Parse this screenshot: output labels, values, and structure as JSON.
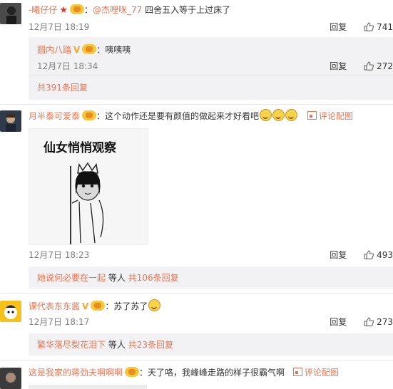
{
  "comments": [
    {
      "user": "-曦仔仔",
      "mention": "@杰哩咪_77",
      "text": "四舍五入等于上过床了",
      "time": "12月7日 18:19",
      "reply_label": "回复",
      "likes": "741",
      "sub_reply": {
        "user": "圆内八踏",
        "text": "：咦咦咦",
        "time": "12月7日 18:34",
        "reply_label": "回复",
        "likes": "272"
      },
      "total_replies": "共391条回复"
    },
    {
      "user": "月半泰可爱泰",
      "text": "：这个动作还是要有颜值的做起来才好看吧",
      "image_link": "评论配图",
      "meme_caption": "仙女悄悄观察",
      "time": "12月7日 18:23",
      "reply_label": "回复",
      "likes": "493",
      "reply_summary": {
        "user": "她说何必要在一起",
        "others": "等人",
        "count": "共106条回复"
      }
    },
    {
      "user": "课代表东东酱",
      "text": "：苏了苏了",
      "time": "12月7日 18:17",
      "reply_label": "回复",
      "likes": "273",
      "reply_summary": {
        "user": "繁华落尽梨花泪下",
        "others": "等人",
        "count": "共23条回复"
      }
    },
    {
      "user": "这是我家的蒋劲夫啊啊啊",
      "text": "：天了咯，我峰峰走路的样子很霸气啊",
      "image_link": "评论配图"
    }
  ],
  "colors": {
    "link": "#eb7350",
    "reply_bg": "#f2f2f5"
  }
}
